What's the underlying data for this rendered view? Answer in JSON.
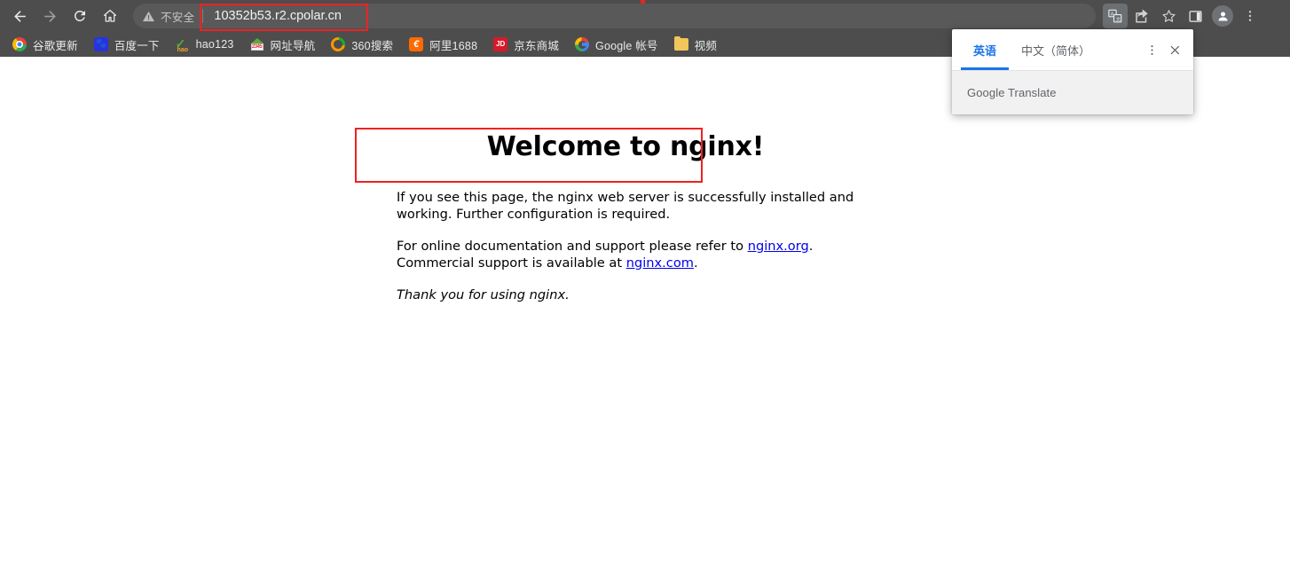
{
  "browser": {
    "nav": {
      "back": "back-arrow",
      "forward": "forward-arrow",
      "reload": "reload",
      "home": "home"
    },
    "omnibox": {
      "security_label": "不安全",
      "security_icon": "warning-triangle-icon",
      "url": "10352b53.r2.cpolar.cn"
    },
    "toolbar_right": [
      {
        "name": "translate-icon",
        "active": true
      },
      {
        "name": "share-icon",
        "active": false
      },
      {
        "name": "bookmark-star-icon",
        "active": false
      },
      {
        "name": "side-panel-icon",
        "active": false
      },
      {
        "name": "profile-avatar-icon",
        "active": false
      },
      {
        "name": "chrome-menu-icon",
        "active": false
      }
    ],
    "bookmarks": [
      {
        "label": "谷歌更新",
        "icon": "chrome-icon"
      },
      {
        "label": "百度一下",
        "icon": "baidu-icon"
      },
      {
        "label": "hao123",
        "icon": "hao123-icon"
      },
      {
        "label": "网址导航",
        "icon": "2345-icon"
      },
      {
        "label": "360搜索",
        "icon": "360-icon"
      },
      {
        "label": "阿里1688",
        "icon": "alibaba-icon"
      },
      {
        "label": "京东商城",
        "icon": "jd-icon"
      },
      {
        "label": "Google 帐号",
        "icon": "google-icon"
      },
      {
        "label": "视频",
        "icon": "folder-icon"
      }
    ],
    "colors": {
      "chrome_bg": "#4d4d4d",
      "omnibox_bg": "#595959",
      "annotation_red": "#ee2222",
      "accent_blue": "#1a73e8",
      "link_blue": "#0000ee"
    }
  },
  "translate_bubble": {
    "tabs": [
      {
        "label": "英语",
        "selected": true
      },
      {
        "label": "中文（简体）",
        "selected": false
      }
    ],
    "more_icon": "kebab-menu-icon",
    "close_icon": "close-icon",
    "footer": "Google Translate"
  },
  "page": {
    "heading": "Welcome to nginx!",
    "paragraph1": "If you see this page, the nginx web server is successfully installed and working. Further configuration is required.",
    "paragraph2_pre": "For online documentation and support please refer to ",
    "link1": "nginx.org",
    "paragraph2_mid": ". Commercial support is available at ",
    "link2": "nginx.com",
    "paragraph2_post": ".",
    "thanks": "Thank you for using nginx."
  }
}
